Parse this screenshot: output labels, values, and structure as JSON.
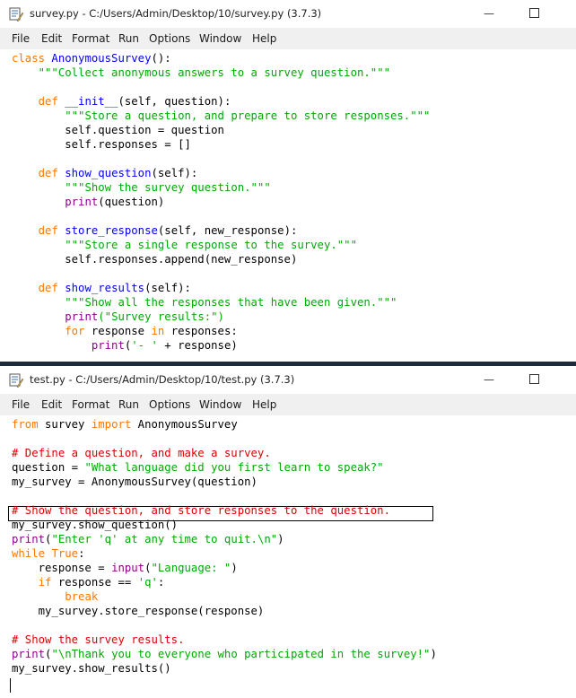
{
  "window1": {
    "title": "survey.py - C:/Users/Admin/Desktop/10/survey.py (3.7.3)",
    "min_symbol": "—",
    "menu": [
      "File",
      "Edit",
      "Format",
      "Run",
      "Options",
      "Window",
      "Help"
    ],
    "code": [
      [
        [
          "kw",
          "class "
        ],
        [
          "df",
          "AnonymousSurvey"
        ],
        [
          "",
          "():"
        ]
      ],
      [
        [
          "",
          "    "
        ],
        [
          "st",
          "\"\"\"Collect anonymous answers to a survey question.\"\"\""
        ]
      ],
      [],
      [
        [
          "",
          "    "
        ],
        [
          "kw",
          "def "
        ],
        [
          "df",
          "__init__"
        ],
        [
          "",
          "(self, question):"
        ]
      ],
      [
        [
          "",
          "        "
        ],
        [
          "st",
          "\"\"\"Store a question, and prepare to store responses.\"\"\""
        ]
      ],
      [
        [
          "",
          "        self.question = question"
        ]
      ],
      [
        [
          "",
          "        self.responses = []"
        ]
      ],
      [],
      [
        [
          "",
          "    "
        ],
        [
          "kw",
          "def "
        ],
        [
          "df",
          "show_question"
        ],
        [
          "",
          "(self):"
        ]
      ],
      [
        [
          "",
          "        "
        ],
        [
          "st",
          "\"\"\"Show the survey question.\"\"\""
        ]
      ],
      [
        [
          "",
          "        "
        ],
        [
          "bi",
          "print"
        ],
        [
          "",
          "(question)"
        ]
      ],
      [],
      [
        [
          "",
          "    "
        ],
        [
          "kw",
          "def "
        ],
        [
          "df",
          "store_response"
        ],
        [
          "",
          "(self, new_response):"
        ]
      ],
      [
        [
          "",
          "        "
        ],
        [
          "st",
          "\"\"\"Store a single response to the survey.\"\"\""
        ]
      ],
      [
        [
          "",
          "        self.responses.append(new_response)"
        ]
      ],
      [],
      [
        [
          "",
          "    "
        ],
        [
          "kw",
          "def "
        ],
        [
          "df",
          "show_results"
        ],
        [
          "",
          "(self):"
        ]
      ],
      [
        [
          "",
          "        "
        ],
        [
          "st",
          "\"\"\"Show all the responses that have been given.\"\"\""
        ]
      ],
      [
        [
          "",
          "        "
        ],
        [
          "bi",
          "print"
        ],
        [
          "",
          ""
        ],
        [
          "st",
          "(\"Survey results:\")"
        ]
      ],
      [
        [
          "",
          "        "
        ],
        [
          "kw",
          "for"
        ],
        [
          "",
          " response "
        ],
        [
          "kw",
          "in"
        ],
        [
          "",
          " responses:"
        ]
      ],
      [
        [
          "",
          "            "
        ],
        [
          "bi",
          "print"
        ],
        [
          "",
          "("
        ],
        [
          "st",
          "'- '"
        ],
        [
          "",
          " + response)"
        ]
      ]
    ]
  },
  "window2": {
    "title": "test.py - C:/Users/Admin/Desktop/10/test.py (3.7.3)",
    "min_symbol": "—",
    "menu": [
      "File",
      "Edit",
      "Format",
      "Run",
      "Options",
      "Window",
      "Help"
    ],
    "code": [
      [
        [
          "kw",
          "from"
        ],
        [
          "",
          " survey "
        ],
        [
          "kw",
          "import"
        ],
        [
          "",
          " AnonymousSurvey"
        ]
      ],
      [],
      [
        [
          "cm",
          "# Define a question, and make a survey."
        ]
      ],
      [
        [
          "",
          "question = "
        ],
        [
          "st",
          "\"What language did you first learn to speak?\""
        ]
      ],
      [
        [
          "",
          "my_survey = AnonymousSurvey(question)"
        ]
      ],
      [],
      [
        [
          "cm",
          "# Show the question, and store responses to the question."
        ]
      ],
      [
        [
          "",
          "my_survey.show_question()"
        ]
      ],
      [
        [
          "bi",
          "print"
        ],
        [
          "",
          "("
        ],
        [
          "st",
          "\"Enter 'q' at any time to quit.\\n\""
        ],
        [
          "",
          ")"
        ]
      ],
      [
        [
          "kw",
          "while"
        ],
        [
          "",
          " "
        ],
        [
          "kw",
          "True"
        ],
        [
          "",
          ":"
        ]
      ],
      [
        [
          "",
          "    response = "
        ],
        [
          "bi",
          "input"
        ],
        [
          "",
          "("
        ],
        [
          "st",
          "\"Language: \""
        ],
        [
          "",
          ")"
        ]
      ],
      [
        [
          "",
          "    "
        ],
        [
          "kw",
          "if"
        ],
        [
          "",
          " response == "
        ],
        [
          "st",
          "'q'"
        ],
        [
          "",
          ":"
        ]
      ],
      [
        [
          "",
          "        "
        ],
        [
          "kw",
          "break"
        ]
      ],
      [
        [
          "",
          "    my_survey.store_response(response)"
        ]
      ],
      [],
      [
        [
          "cm",
          "# Show the survey results."
        ]
      ],
      [
        [
          "bi",
          "print"
        ],
        [
          "",
          "("
        ],
        [
          "st",
          "\"\\nThank you to everyone who participated in the survey!\""
        ],
        [
          "",
          ")"
        ]
      ],
      [
        [
          "",
          "my_survey.show_results()"
        ]
      ]
    ]
  }
}
